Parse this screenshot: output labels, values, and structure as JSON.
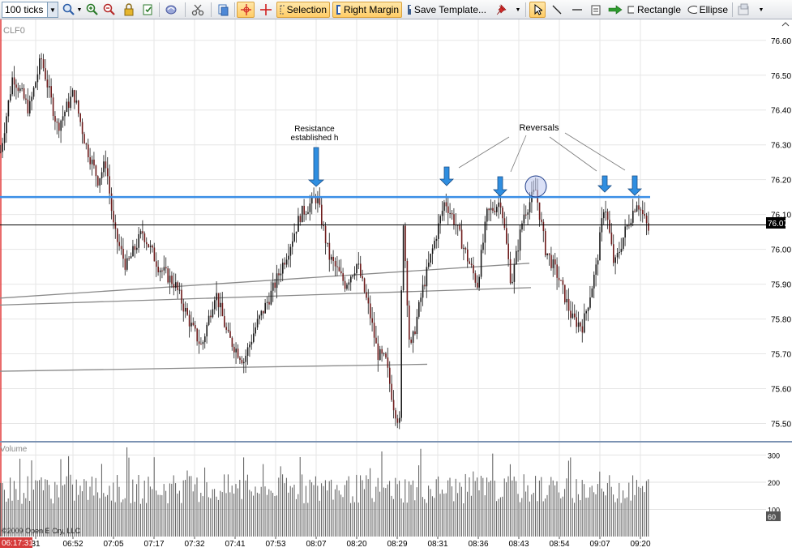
{
  "toolbar": {
    "ticks_value": "100 ticks",
    "selection_label": "Selection",
    "right_margin_label": "Right Margin",
    "save_template_label": "Save Template...",
    "rectangle_label": "Rectangle",
    "ellipse_label": "Ellipse",
    "icons": [
      "zoom-icon",
      "zoom-in-icon",
      "zoom-out-icon",
      "lock-icon",
      "export-icon",
      "properties-icon",
      "scissors-icon",
      "copy-icon",
      "crosshair-icon",
      "cross-icon",
      "pointer-icon",
      "line-icon",
      "hline-icon",
      "notepad-icon",
      "arrow-icon"
    ]
  },
  "chart": {
    "instrument": "CLF0",
    "price_ticks": [
      "76.60",
      "76.50",
      "76.40",
      "76.30",
      "76.20",
      "76.10",
      "76.00",
      "75.90",
      "75.80",
      "75.70",
      "75.60",
      "75.50"
    ],
    "current_price": "76.07",
    "annotations": {
      "resistance": [
        "Resistance",
        "established h"
      ],
      "reversals": "Reversals"
    }
  },
  "volume": {
    "label": "Volume",
    "ticks": [
      "300",
      "200",
      "100"
    ],
    "current_value": "60",
    "copyright": "©2009 Open E Cry, LLC"
  },
  "time_axis": {
    "cursor_time": "06:17:31",
    "labels": [
      "31",
      "06:52",
      "07:05",
      "07:17",
      "07:32",
      "07:41",
      "07:53",
      "08:07",
      "08:20",
      "08:29",
      "08:31",
      "08:36",
      "08:43",
      "08:54",
      "09:07",
      "09:20"
    ]
  },
  "chart_data": {
    "type": "candlestick",
    "price_range": [
      75.45,
      76.66
    ],
    "volume_range": [
      0,
      340
    ],
    "resistance_level": 76.15,
    "current_price": 76.07,
    "trendlines": [
      {
        "from": [
          0,
          75.86
        ],
        "to": [
          653,
          75.96
        ]
      },
      {
        "from": [
          0,
          75.84
        ],
        "to": [
          655,
          75.89
        ]
      },
      {
        "from": [
          0,
          75.65
        ],
        "to": [
          527,
          75.67
        ]
      }
    ],
    "price_anchors": [
      [
        0,
        76.28
      ],
      [
        15,
        76.5
      ],
      [
        35,
        76.4
      ],
      [
        50,
        76.55
      ],
      [
        70,
        76.35
      ],
      [
        90,
        76.45
      ],
      [
        105,
        76.3
      ],
      [
        120,
        76.2
      ],
      [
        130,
        76.25
      ],
      [
        140,
        76.05
      ],
      [
        155,
        75.95
      ],
      [
        175,
        76.05
      ],
      [
        195,
        75.95
      ],
      [
        215,
        75.9
      ],
      [
        235,
        75.78
      ],
      [
        248,
        75.72
      ],
      [
        265,
        75.88
      ],
      [
        280,
        75.75
      ],
      [
        300,
        75.68
      ],
      [
        315,
        75.78
      ],
      [
        335,
        75.88
      ],
      [
        355,
        76.0
      ],
      [
        370,
        76.1
      ],
      [
        390,
        76.15
      ],
      [
        405,
        75.98
      ],
      [
        425,
        75.9
      ],
      [
        440,
        75.96
      ],
      [
        455,
        75.82
      ],
      [
        465,
        75.7
      ],
      [
        475,
        75.68
      ],
      [
        485,
        75.55
      ],
      [
        492,
        75.5
      ],
      [
        496,
        76.12
      ],
      [
        505,
        75.7
      ],
      [
        520,
        75.88
      ],
      [
        535,
        76.02
      ],
      [
        548,
        76.14
      ],
      [
        560,
        76.08
      ],
      [
        575,
        75.98
      ],
      [
        588,
        75.9
      ],
      [
        600,
        76.1
      ],
      [
        617,
        76.14
      ],
      [
        630,
        75.9
      ],
      [
        645,
        76.1
      ],
      [
        660,
        76.17
      ],
      [
        672,
        76.0
      ],
      [
        688,
        75.92
      ],
      [
        705,
        75.8
      ],
      [
        718,
        75.78
      ],
      [
        735,
        75.95
      ],
      [
        745,
        76.14
      ],
      [
        757,
        75.95
      ],
      [
        770,
        76.05
      ],
      [
        785,
        76.14
      ],
      [
        800,
        76.05
      ]
    ]
  }
}
